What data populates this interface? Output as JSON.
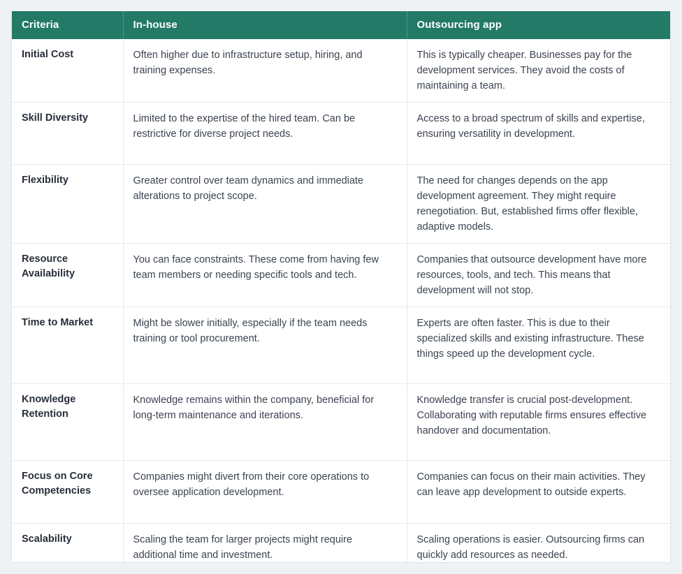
{
  "table": {
    "accent_color": "#237a67",
    "header_text_color": "#ffffff",
    "body_text_color": "#3b4350",
    "criteria_text_color": "#272e3a",
    "grid_line_color": "#e4e9ef",
    "page_background": "#eff2f5",
    "table_background": "#ffffff",
    "columns": [
      "Criteria",
      "In-house",
      "Outsourcing app"
    ],
    "rows": [
      {
        "criteria": "Initial Cost",
        "in_house": "Often higher due to infrastructure setup, hiring, and training expenses.",
        "outsourcing": "This is typically cheaper. Businesses pay for the development services. They avoid the costs of maintaining a team."
      },
      {
        "criteria": "Skill Diversity",
        "in_house": "Limited to the expertise of the hired team. Can be restrictive for diverse project needs.",
        "outsourcing": "Access to a broad spectrum of skills and expertise, ensuring versatility in development."
      },
      {
        "criteria": "Flexibility",
        "in_house": "Greater control over team dynamics and immediate alterations to project scope.",
        "outsourcing": "The need for changes depends on the app development agreement. They might require renegotiation. But, established firms offer flexible, adaptive models."
      },
      {
        "criteria": "Resource Availability",
        "in_house": "You can face constraints. These come from having few team members or needing specific tools and tech.",
        "outsourcing": "Companies that outsource development have more resources, tools, and tech. This means that development will not stop."
      },
      {
        "criteria": "Time to Market",
        "in_house": "Might be slower initially, especially if the team needs training or tool procurement.",
        "outsourcing": "Experts are often faster. This is due to their specialized skills and existing infrastructure. These things speed up the development cycle."
      },
      {
        "criteria": "Knowledge Retention",
        "in_house": "Knowledge remains within the company, beneficial for long-term maintenance and iterations.",
        "outsourcing": "Knowledge transfer is crucial post-development. Collaborating with reputable firms ensures effective handover and documentation."
      },
      {
        "criteria": "Focus on Core Competencies",
        "in_house": "Companies might divert from their core operations to oversee application development.",
        "outsourcing": "Companies can focus on their main activities. They can leave app development to outside experts."
      },
      {
        "criteria": "Scalability",
        "in_house": "Scaling the team for larger projects might require additional time and investment.",
        "outsourcing": "Scaling operations is easier. Outsourcing firms can quickly add resources as needed."
      }
    ]
  }
}
